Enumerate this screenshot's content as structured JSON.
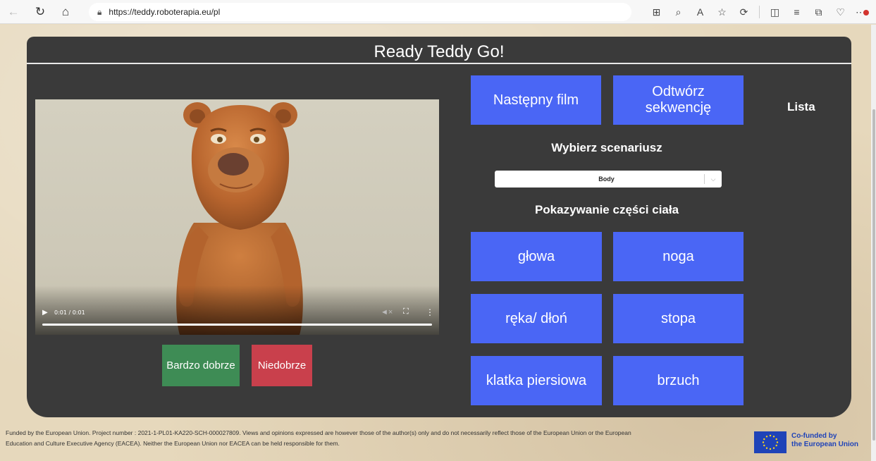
{
  "browser": {
    "url": "https://teddy.roboterapia.eu/pl",
    "icons": [
      "back-icon",
      "refresh-icon",
      "home-icon",
      "lock-icon",
      "grid-icon",
      "zoom-icon",
      "read-aloud-icon",
      "favorite-icon",
      "extensions-icon",
      "split-screen-icon",
      "favorites-list-icon",
      "collections-icon",
      "browser-essentials-icon",
      "more-icon"
    ]
  },
  "page": {
    "title": "Ready Teddy Go!",
    "video": {
      "time": "0:01 / 0:01",
      "progress": 1.0
    },
    "feedback": {
      "good_label": "Bardzo dobrze",
      "bad_label": "Niedobrze"
    },
    "top_buttons": {
      "next_label": "Następny film",
      "replay_label": "Odtwórz sekwencję"
    },
    "list_label": "Lista",
    "scenario_label": "Wybierz scenariusz",
    "scenario_select": {
      "value": "Body"
    },
    "section_label": "Pokazywanie części ciała",
    "body_parts": [
      "głowa",
      "noga",
      "ręka/ dłoń",
      "stopa",
      "klatka piersiowa",
      "brzuch"
    ]
  },
  "footer": {
    "line1": "Funded by the European Union. Project number : 2021-1-PL01-KA220-SCH-000027809. Views and opinions expressed are however those of the author(s) only and do not necessarily reflect those of the European Union or the European",
    "line2": "Education and Culture Executive Agency (EACEA). Neither the European Union nor EACEA can be held responsible for them.",
    "eu_line1": "Co-funded by",
    "eu_line2": "the European Union"
  },
  "colors": {
    "panel": "#3a3a3a",
    "blue_button": "#4a66f5",
    "good_button": "#3e8c55",
    "bad_button": "#c9404c",
    "eu_blue": "#1f43b8"
  }
}
